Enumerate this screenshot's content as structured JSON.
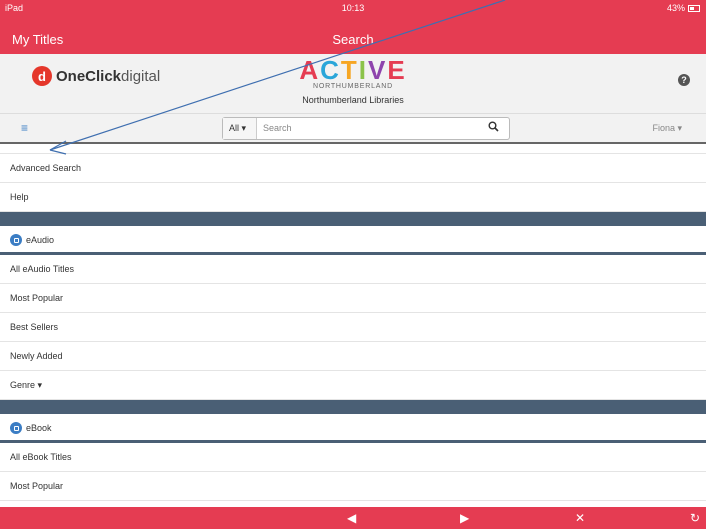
{
  "statusbar": {
    "carrier": "iPad",
    "time": "10:13",
    "battery": "43%"
  },
  "navbar": {
    "back_label": "My Titles",
    "title": "Search"
  },
  "header": {
    "brand_bold": "OneClick",
    "brand_thin": "digital",
    "active_word": [
      "A",
      "C",
      "T",
      "I",
      "V",
      "E"
    ],
    "active_sub": "NORTHUMBERLAND",
    "library": "Northumberland Libraries"
  },
  "search": {
    "scope": "All ▾",
    "placeholder": "Search",
    "user": "Fiona ▾"
  },
  "menu": {
    "top_items": [
      "Advanced Search",
      "Help"
    ],
    "eaudio": {
      "label": "eAudio",
      "items": [
        "All eAudio Titles",
        "Most Popular",
        "Best Sellers",
        "Newly Added",
        "Genre ▾"
      ]
    },
    "ebook": {
      "label": "eBook",
      "items": [
        "All eBook Titles",
        "Most Popular"
      ]
    }
  },
  "colors": {
    "brand_red": "#e53c52",
    "section_bar": "#4a5f75",
    "link_blue": "#3b7dc4"
  }
}
